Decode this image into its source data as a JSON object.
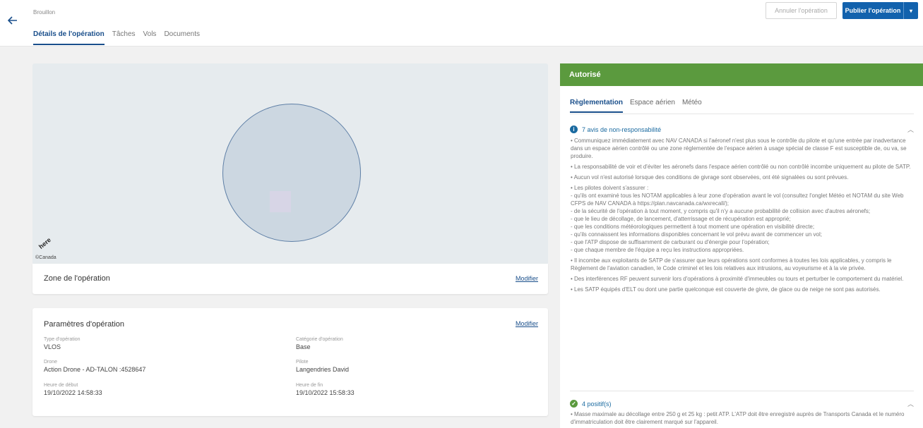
{
  "header": {
    "status": "Brouillon",
    "tabs": [
      "Détails de l'opération",
      "Tâches",
      "Vols",
      "Documents"
    ],
    "cancel_label": "Annuler l'opération",
    "publish_label": "Publier l'opération"
  },
  "map": {
    "logo": "here",
    "copyright": "©Canada"
  },
  "zone": {
    "title": "Zone de l'opération",
    "edit_label": "Modifier"
  },
  "params": {
    "title": "Paramètres d'opération",
    "edit_label": "Modifier",
    "fields": [
      {
        "label": "Type d'opération",
        "value": "VLOS"
      },
      {
        "label": "Catégorie d'opération",
        "value": "Base"
      },
      {
        "label": "Drone",
        "value": "Action Drone - AD-TALON :4528647"
      },
      {
        "label": "Pilote",
        "value": "Langendries David"
      },
      {
        "label": "Heure de début",
        "value": "19/10/2022 14:58:33"
      },
      {
        "label": "Heure de fin",
        "value": "19/10/2022 15:58:33"
      }
    ]
  },
  "authorization": {
    "status": "Autorisé",
    "status_color": "#5b9a3e",
    "tabs": [
      "Règlementation",
      "Espace aérien",
      "Météo"
    ],
    "disclaimers_title": "7 avis de non-responsabilité",
    "disclaimers": [
      "• Communiquez immédiatement avec NAV CANADA si l'aéronef n'est plus sous le contrôle du pilote et qu'une entrée par inadvertance dans un espace aérien contrôlé ou une zone réglementée de l'espace aérien à usage spécial de classe F est susceptible de, ou va, se produire.",
      "• La responsabilité de voir et d'éviter les aéronefs dans l'espace aérien contrôlé ou non contrôlé incombe uniquement au pilote de SATP.",
      "• Aucun vol n'est autorisé lorsque des conditions de givrage sont observées, ont été signalées ou sont prévues.",
      "• Les pilotes doivent s'assurer :\n- qu'ils ont examiné tous les NOTAM applicables à leur zone d'opération avant le vol (consultez l'onglet Météo et NOTAM du site Web CFPS de NAV CANADA à https://plan.navcanada.ca/wxrecall/);\n- de la sécurité de l'opération à tout moment, y compris qu'il n'y a aucune probabilité de collision avec d'autres aéronefs;\n- que le lieu de décollage, de lancement, d'atterrissage et de récupération est approprié;\n- que les conditions météorologiques permettent à tout moment une opération en visibilité directe;\n- qu'ils connaissent les informations disponibles concernant le vol prévu avant de commencer un vol;\n- que l'ATP dispose de suffisamment de carburant ou d'énergie pour l'opération;\n- que chaque membre de l'équipe a reçu les instructions appropriées.",
      "• Il incombe aux exploitants de SATP de s'assurer que leurs opérations sont conformes à toutes les lois applicables, y compris le Règlement de l'aviation canadien, le Code criminel et les lois relatives aux intrusions, au voyeurisme et à la vie privée.",
      "• Des interférences RF peuvent survenir lors d'opérations à proximité d'immeubles ou tours et perturber le comportement du matériel.",
      "• Les SATP équipés d'ELT ou dont une partie quelconque est couverte de givre, de glace ou de neige ne sont pas autorisés."
    ],
    "positives_title": "4 positif(s)",
    "positives": [
      "• Masse maximale au décollage entre 250 g et 25 kg : petit ATP. L'ATP doit être enregistré auprès de Transports Canada et le numéro d'immatriculation doit être clairement marqué sur l'appareil."
    ]
  }
}
